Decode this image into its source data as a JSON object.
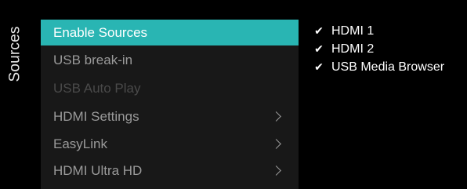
{
  "side_title": "Sources",
  "menu": {
    "items": [
      {
        "label": "Enable Sources",
        "state": "selected",
        "has_submenu": false
      },
      {
        "label": "USB break-in",
        "state": "normal",
        "has_submenu": false
      },
      {
        "label": "USB Auto Play",
        "state": "disabled",
        "has_submenu": false
      },
      {
        "label": "HDMI Settings",
        "state": "normal",
        "has_submenu": true
      },
      {
        "label": "EasyLink",
        "state": "normal",
        "has_submenu": true
      },
      {
        "label": "HDMI Ultra HD",
        "state": "normal",
        "has_submenu": true
      }
    ]
  },
  "submenu": {
    "items": [
      {
        "label": "HDMI 1",
        "checked": true,
        "icon": "checkmark-icon"
      },
      {
        "label": "HDMI 2",
        "checked": true,
        "icon": "checkmark-icon"
      },
      {
        "label": "USB Media Browser",
        "checked": true,
        "icon": "checkmark-icon"
      }
    ]
  },
  "colors": {
    "background": "#000000",
    "panel": "#181818",
    "selection": "#29b5b3",
    "text_active": "#ffffff",
    "text_normal": "#9a9a9a",
    "text_disabled": "#4a4a4a"
  }
}
